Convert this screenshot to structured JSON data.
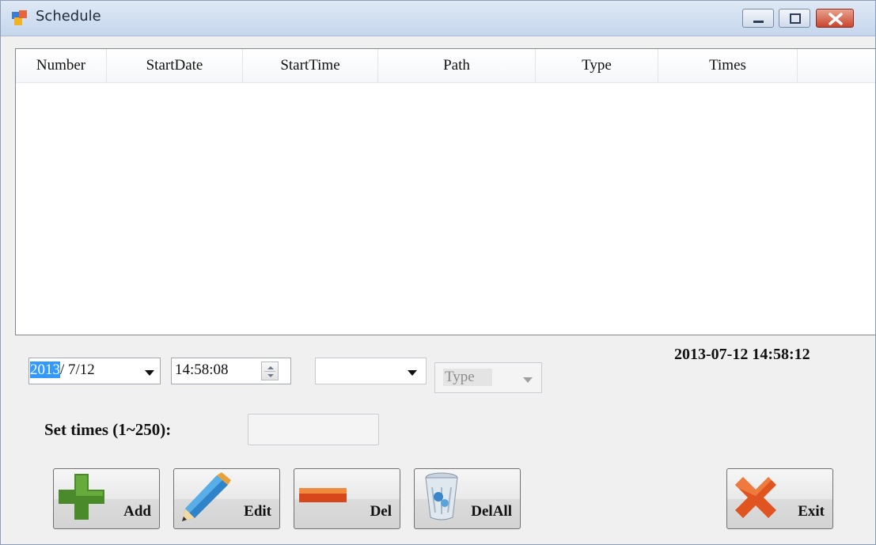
{
  "window": {
    "title": "Schedule"
  },
  "list": {
    "columns": [
      "Number",
      "StartDate",
      "StartTime",
      "Path",
      "Type",
      "Times"
    ]
  },
  "controls": {
    "date_year": "2013",
    "date_rest": "/  7/12",
    "time_value": "14:58:08",
    "path_value": "",
    "type_placeholder": "Type",
    "clock": "2013-07-12 14:58:12",
    "set_times_label": "Set times (1~250):",
    "set_times_value": ""
  },
  "buttons": {
    "add": "Add",
    "edit": "Edit",
    "del": "Del",
    "delall": "DelAll",
    "exit": "Exit"
  },
  "icons": {
    "app": "app-window-icon",
    "minimize": "minimize-icon",
    "maximize": "maximize-icon",
    "close": "close-icon",
    "add": "plus-icon",
    "edit": "pencil-icon",
    "del": "minus-icon",
    "delall": "recycle-bin-icon",
    "exit": "x-icon"
  }
}
